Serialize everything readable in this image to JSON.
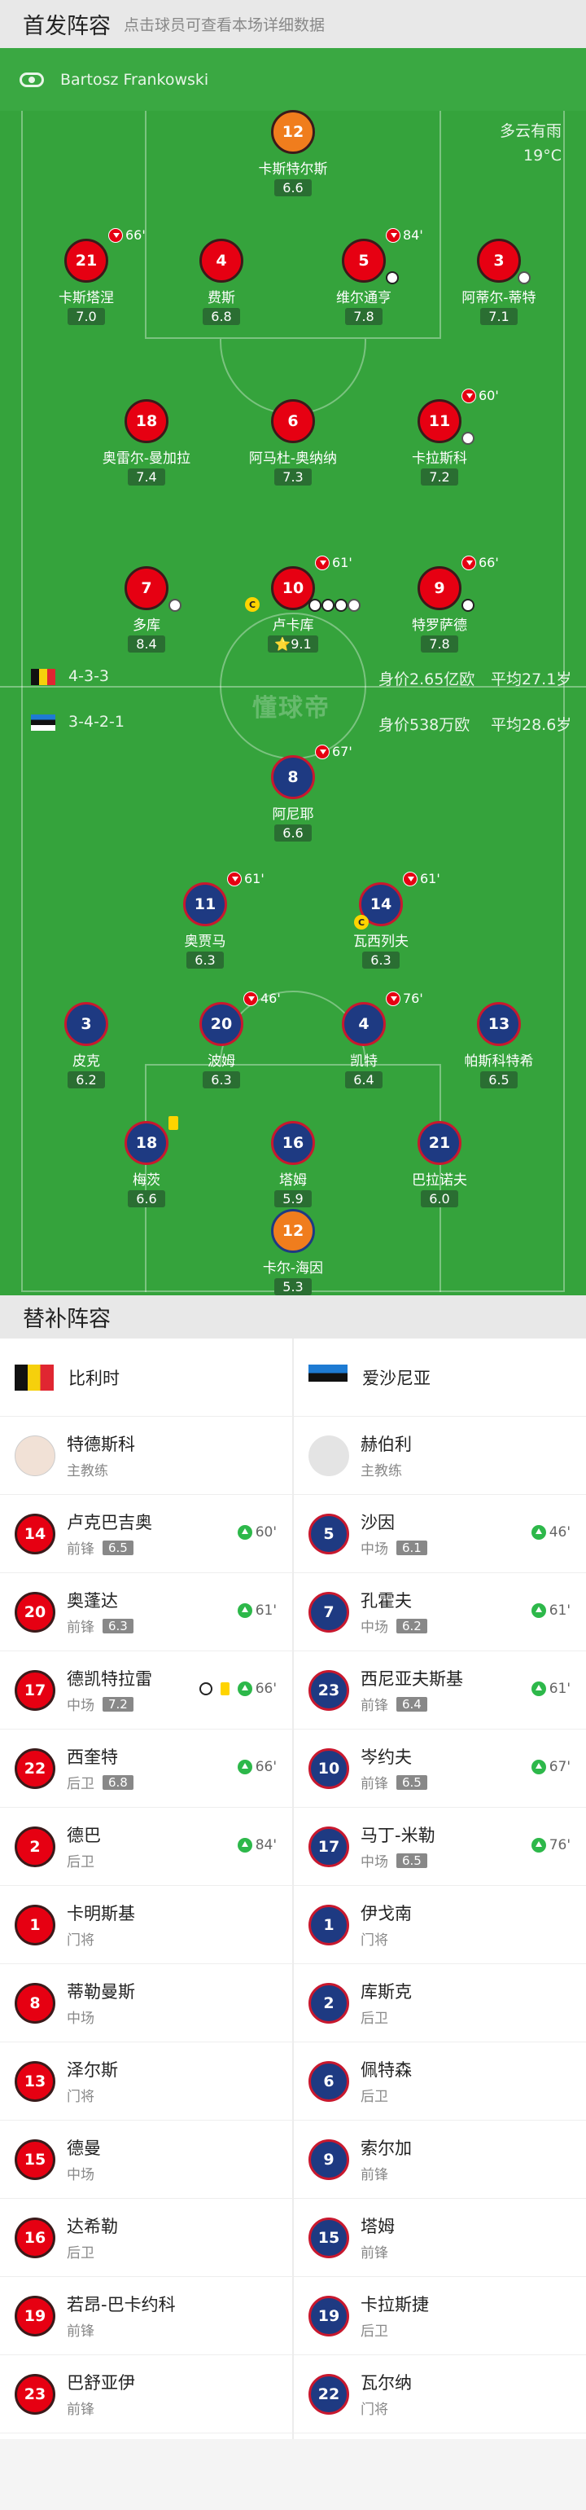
{
  "starting_header": {
    "title": "首发阵容",
    "hint": "点击球员可查看本场详细数据"
  },
  "referee": "Bartosz Frankowski",
  "weather": {
    "condition": "多云有雨",
    "temp": "19°C"
  },
  "watermark": "懂球帝",
  "belgium_summary": {
    "formation": "4-3-3",
    "value": "身价2.65亿欧",
    "age": "平均27.1岁"
  },
  "estonia_summary": {
    "formation": "3-4-2-1",
    "value": "身价538万欧",
    "age": "平均28.6岁"
  },
  "home_starters": [
    {
      "num": "12",
      "name": "卡斯特尔斯",
      "rating": "6.6"
    },
    {
      "num": "21",
      "name": "卡斯塔涅",
      "rating": "7.0",
      "sub": "66'"
    },
    {
      "num": "4",
      "name": "费斯",
      "rating": "6.8"
    },
    {
      "num": "5",
      "name": "维尔通亨",
      "rating": "7.8",
      "sub": "84'"
    },
    {
      "num": "3",
      "name": "阿蒂尔-蒂特",
      "rating": "7.1"
    },
    {
      "num": "18",
      "name": "奥雷尔-曼加拉",
      "rating": "7.4"
    },
    {
      "num": "6",
      "name": "阿马杜-奥纳纳",
      "rating": "7.3"
    },
    {
      "num": "11",
      "name": "卡拉斯科",
      "rating": "7.2",
      "sub": "60'"
    },
    {
      "num": "7",
      "name": "多库",
      "rating": "8.4"
    },
    {
      "num": "10",
      "name": "卢卡库",
      "rating": "9.1",
      "sub": "61'"
    },
    {
      "num": "9",
      "name": "特罗萨德",
      "rating": "7.8",
      "sub": "66'"
    }
  ],
  "away_starters": [
    {
      "num": "8",
      "name": "阿尼耶",
      "rating": "6.6",
      "sub": "67'"
    },
    {
      "num": "11",
      "name": "奥贾马",
      "rating": "6.3",
      "sub": "61'"
    },
    {
      "num": "14",
      "name": "瓦西列夫",
      "rating": "6.3",
      "sub": "61'"
    },
    {
      "num": "3",
      "name": "皮克",
      "rating": "6.2"
    },
    {
      "num": "20",
      "name": "波姆",
      "rating": "6.3",
      "sub": "46'"
    },
    {
      "num": "4",
      "name": "凯特",
      "rating": "6.4",
      "sub": "76'"
    },
    {
      "num": "13",
      "name": "帕斯科特希",
      "rating": "6.5"
    },
    {
      "num": "18",
      "name": "梅茨",
      "rating": "6.6"
    },
    {
      "num": "16",
      "name": "塔姆",
      "rating": "5.9"
    },
    {
      "num": "21",
      "name": "巴拉诺夫",
      "rating": "6.0"
    },
    {
      "num": "12",
      "name": "卡尔-海因",
      "rating": "5.3"
    }
  ],
  "bench_header": {
    "title": "替补阵容"
  },
  "bench": {
    "home": {
      "team": "比利时",
      "coach": {
        "name": "特德斯科",
        "role": "主教练"
      },
      "players": [
        {
          "num": "14",
          "name": "卢克巴吉奥",
          "pos": "前锋",
          "rating": "6.5",
          "in": "60'"
        },
        {
          "num": "20",
          "name": "奥蓬达",
          "pos": "前锋",
          "rating": "6.3",
          "in": "61'"
        },
        {
          "num": "17",
          "name": "德凯特拉雷",
          "pos": "中场",
          "rating": "7.2",
          "in": "66'"
        },
        {
          "num": "22",
          "name": "西奎特",
          "pos": "后卫",
          "rating": "6.8",
          "in": "66'"
        },
        {
          "num": "2",
          "name": "德巴",
          "pos": "后卫",
          "rating": "",
          "in": "84'"
        },
        {
          "num": "1",
          "name": "卡明斯基",
          "pos": "门将"
        },
        {
          "num": "8",
          "name": "蒂勒曼斯",
          "pos": "中场"
        },
        {
          "num": "13",
          "name": "泽尔斯",
          "pos": "门将"
        },
        {
          "num": "15",
          "name": "德曼",
          "pos": "中场"
        },
        {
          "num": "16",
          "name": "达希勒",
          "pos": "后卫"
        },
        {
          "num": "19",
          "name": "若昂-巴卡约科",
          "pos": "前锋"
        },
        {
          "num": "23",
          "name": "巴舒亚伊",
          "pos": "前锋"
        }
      ]
    },
    "away": {
      "team": "爱沙尼亚",
      "coach": {
        "name": "赫伯利",
        "role": "主教练"
      },
      "players": [
        {
          "num": "5",
          "name": "沙因",
          "pos": "中场",
          "rating": "6.1",
          "in": "46'"
        },
        {
          "num": "7",
          "name": "孔霍夫",
          "pos": "中场",
          "rating": "6.2",
          "in": "61'"
        },
        {
          "num": "23",
          "name": "西尼亚夫斯基",
          "pos": "前锋",
          "rating": "6.4",
          "in": "61'"
        },
        {
          "num": "10",
          "name": "岑约夫",
          "pos": "前锋",
          "rating": "6.5",
          "in": "67'"
        },
        {
          "num": "17",
          "name": "马丁-米勒",
          "pos": "中场",
          "rating": "6.5",
          "in": "76'"
        },
        {
          "num": "1",
          "name": "伊戈南",
          "pos": "门将"
        },
        {
          "num": "2",
          "name": "库斯克",
          "pos": "后卫"
        },
        {
          "num": "6",
          "name": "佩特森",
          "pos": "后卫"
        },
        {
          "num": "9",
          "name": "索尔加",
          "pos": "前锋"
        },
        {
          "num": "15",
          "name": "塔姆",
          "pos": "前锋"
        },
        {
          "num": "19",
          "name": "卡拉斯捷",
          "pos": "后卫"
        },
        {
          "num": "22",
          "name": "瓦尔纳",
          "pos": "门将"
        }
      ]
    }
  }
}
